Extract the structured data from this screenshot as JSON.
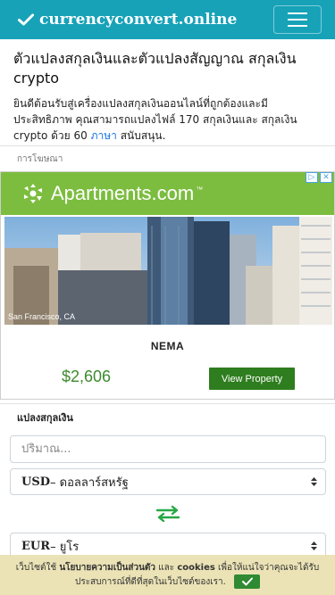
{
  "navbar": {
    "brand": "currencyconvert.online"
  },
  "intro": {
    "title": "ตัวแปลงสกุลเงินและตัวแปลงสัญญาณ สกุลเงิน crypto",
    "desc_before_link": "ยินดีต้อนรับสู่เครื่องแปลงสกุลเงินออนไลน์ที่ถูกต้องและมีประสิทธิภาพ คุณสามารถแปลงไฟล์ 170 สกุลเงินและ สกุลเงิน crypto ด้วย 60 ",
    "desc_link": "ภาษา",
    "desc_after_link": " สนับสนุน."
  },
  "ad": {
    "label": "การโฆษณา",
    "logo": "Apartments.com",
    "logo_tm": "™",
    "photo_caption": "San Francisco, CA",
    "name": "NEMA",
    "price": "$2,606",
    "button": "View Property"
  },
  "converter": {
    "section_title": "แปลงสกุลเงิน",
    "amount_placeholder": "ปริมาณ...",
    "from_code": "USD",
    "from_name": " – ดอลลาร์สหรัฐ",
    "to_code": "EUR",
    "to_name": " – ยูโร"
  },
  "cookie": {
    "text1": "เว็บไซต์ใช้ ",
    "policy": "นโยบายความเป็นส่วนตัว",
    "text2": " และ ",
    "cookies": "cookies",
    "text3": " เพื่อให้แน่ใจว่าคุณจะได้รับประสบการณ์ที่ดีที่สุดในเว็บไซต์ของเรา."
  },
  "colors": {
    "navbar": "#17a2b8",
    "ad_green": "#7cbd3f",
    "button_green": "#2e7d1e",
    "swap_green": "#28a745",
    "link": "#1a73e8"
  }
}
